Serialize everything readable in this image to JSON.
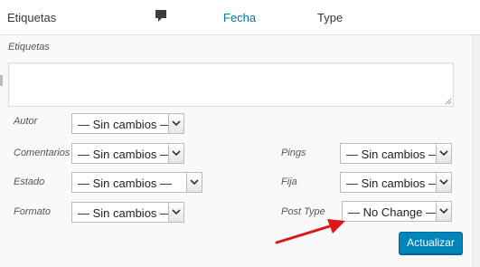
{
  "header": {
    "col_etiquetas": "Etiquetas",
    "col_fecha": "Fecha",
    "col_type": "Type",
    "comment_icon": "comment-bubble-icon"
  },
  "form": {
    "etiquetas_label": "Etiquetas",
    "autor": {
      "label": "Autor",
      "value": "— Sin cambios —"
    },
    "comentarios": {
      "label": "Comentarios",
      "value": "— Sin cambios —"
    },
    "estado": {
      "label": "Estado",
      "value": "— Sin cambios —"
    },
    "formato": {
      "label": "Formato",
      "value": "— Sin cambios —"
    },
    "pings": {
      "label": "Pings",
      "value": "— Sin cambios —"
    },
    "fija": {
      "label": "Fija",
      "value": "— Sin cambios —"
    },
    "post_type": {
      "label": "Post Type",
      "value": "— No Change —"
    },
    "submit_label": "Actualizar"
  },
  "colors": {
    "link": "#0073aa",
    "primary_button": "#0085ba",
    "annotation_arrow": "#d9181d"
  }
}
